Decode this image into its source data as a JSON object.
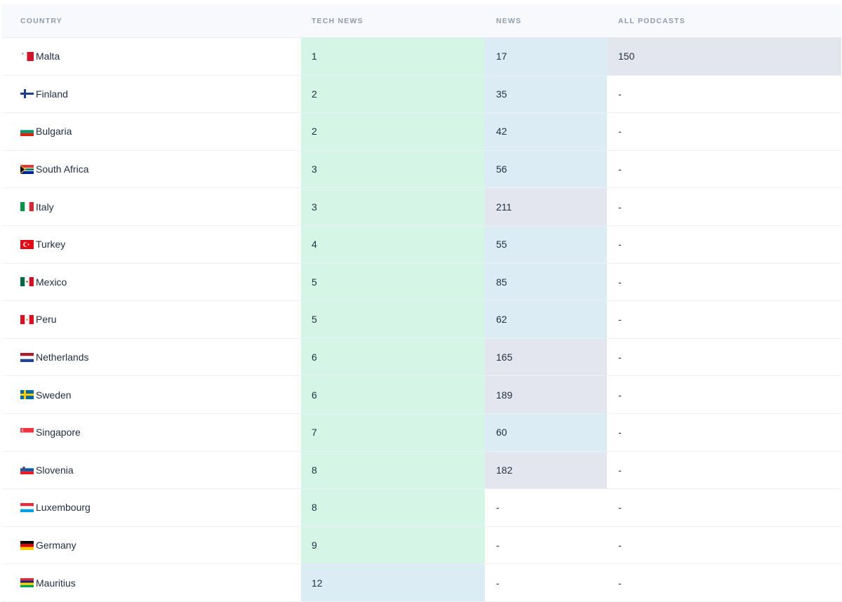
{
  "headers": {
    "country": "COUNTRY",
    "tech_news": "TECH NEWS",
    "news": "NEWS",
    "all_podcasts": "ALL PODCASTS"
  },
  "colors": {
    "mint": "#d5f5e6",
    "sky": "#dcecf4",
    "gray": "#e3e6ee"
  },
  "rows": [
    {
      "country": "Malta",
      "flag": "malta-flag-icon",
      "tech_news": "1",
      "news": "17",
      "all_podcasts": "150"
    },
    {
      "country": "Finland",
      "flag": "finland-flag-icon",
      "tech_news": "2",
      "news": "35",
      "all_podcasts": "-"
    },
    {
      "country": "Bulgaria",
      "flag": "bulgaria-flag-icon",
      "tech_news": "2",
      "news": "42",
      "all_podcasts": "-"
    },
    {
      "country": "South Africa",
      "flag": "south-africa-flag-icon",
      "tech_news": "3",
      "news": "56",
      "all_podcasts": "-"
    },
    {
      "country": "Italy",
      "flag": "italy-flag-icon",
      "tech_news": "3",
      "news": "211",
      "all_podcasts": "-"
    },
    {
      "country": "Turkey",
      "flag": "turkey-flag-icon",
      "tech_news": "4",
      "news": "55",
      "all_podcasts": "-"
    },
    {
      "country": "Mexico",
      "flag": "mexico-flag-icon",
      "tech_news": "5",
      "news": "85",
      "all_podcasts": "-"
    },
    {
      "country": "Peru",
      "flag": "peru-flag-icon",
      "tech_news": "5",
      "news": "62",
      "all_podcasts": "-"
    },
    {
      "country": "Netherlands",
      "flag": "netherlands-flag-icon",
      "tech_news": "6",
      "news": "165",
      "all_podcasts": "-"
    },
    {
      "country": "Sweden",
      "flag": "sweden-flag-icon",
      "tech_news": "6",
      "news": "189",
      "all_podcasts": "-"
    },
    {
      "country": "Singapore",
      "flag": "singapore-flag-icon",
      "tech_news": "7",
      "news": "60",
      "all_podcasts": "-"
    },
    {
      "country": "Slovenia",
      "flag": "slovenia-flag-icon",
      "tech_news": "8",
      "news": "182",
      "all_podcasts": "-"
    },
    {
      "country": "Luxembourg",
      "flag": "luxembourg-flag-icon",
      "tech_news": "8",
      "news": "-",
      "all_podcasts": "-"
    },
    {
      "country": "Germany",
      "flag": "germany-flag-icon",
      "tech_news": "9",
      "news": "-",
      "all_podcasts": "-"
    },
    {
      "country": "Mauritius",
      "flag": "mauritius-flag-icon",
      "tech_news": "12",
      "news": "-",
      "all_podcasts": "-"
    }
  ]
}
